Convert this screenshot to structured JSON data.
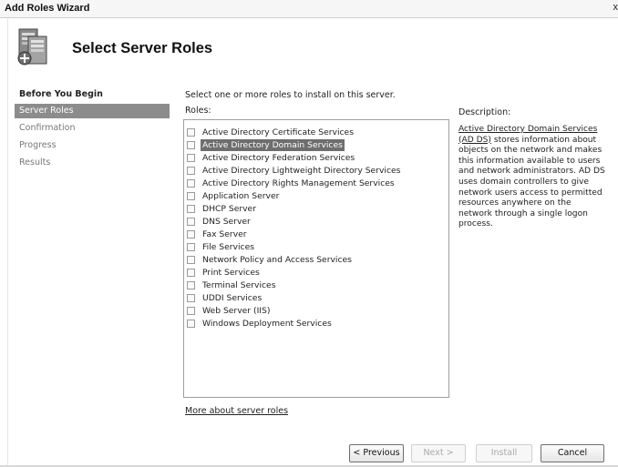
{
  "window": {
    "title": "Add Roles Wizard",
    "close_glyph": "x"
  },
  "header": {
    "heading": "Select Server Roles",
    "icon": "server-roles-icon"
  },
  "nav": {
    "items": [
      {
        "label": "Before You Begin",
        "state": "done"
      },
      {
        "label": "Server Roles",
        "state": "selected"
      },
      {
        "label": "Confirmation",
        "state": "pending"
      },
      {
        "label": "Progress",
        "state": "pending"
      },
      {
        "label": "Results",
        "state": "pending"
      }
    ]
  },
  "main": {
    "instruction": "Select one or more roles to install on this server.",
    "roles_label": "Roles:",
    "roles": [
      {
        "label": "Active Directory Certificate Services",
        "checked": false,
        "selected": false
      },
      {
        "label": "Active Directory Domain Services",
        "checked": false,
        "selected": true
      },
      {
        "label": "Active Directory Federation Services",
        "checked": false,
        "selected": false
      },
      {
        "label": "Active Directory Lightweight Directory Services",
        "checked": false,
        "selected": false
      },
      {
        "label": "Active Directory Rights Management Services",
        "checked": false,
        "selected": false
      },
      {
        "label": "Application Server",
        "checked": false,
        "selected": false
      },
      {
        "label": "DHCP Server",
        "checked": false,
        "selected": false
      },
      {
        "label": "DNS Server",
        "checked": false,
        "selected": false
      },
      {
        "label": "Fax Server",
        "checked": false,
        "selected": false
      },
      {
        "label": "File Services",
        "checked": false,
        "selected": false
      },
      {
        "label": "Network Policy and Access Services",
        "checked": false,
        "selected": false
      },
      {
        "label": "Print Services",
        "checked": false,
        "selected": false
      },
      {
        "label": "Terminal Services",
        "checked": false,
        "selected": false
      },
      {
        "label": "UDDI Services",
        "checked": false,
        "selected": false
      },
      {
        "label": "Web Server (IIS)",
        "checked": false,
        "selected": false
      },
      {
        "label": "Windows Deployment Services",
        "checked": false,
        "selected": false
      }
    ],
    "description_label": "Description:",
    "description_link": "Active Directory Domain Services (AD DS)",
    "description_body": " stores information about objects on the network and makes this information available to users and network administrators. AD DS uses domain controllers to give network users access to permitted resources anywhere on the network through a single logon process.",
    "more_link": "More about server roles"
  },
  "buttons": {
    "previous": "< Previous",
    "next": "Next >",
    "install": "Install",
    "cancel": "Cancel"
  }
}
